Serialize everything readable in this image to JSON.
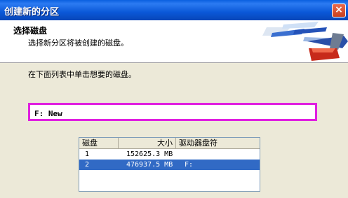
{
  "window": {
    "title": "创建新的分区",
    "close_glyph": "×"
  },
  "header": {
    "title": "选择磁盘",
    "subtitle": "选择新分区将被创建的磁盘。"
  },
  "instruction": "在下面列表中单击想要的磁盘。",
  "selected_field": {
    "value": "F:  New"
  },
  "disk_table": {
    "columns": [
      "磁盘",
      "大小",
      "驱动器盘符"
    ],
    "rows": [
      {
        "disk": "1",
        "size": "152625.3 MB",
        "letter": ""
      },
      {
        "disk": "2",
        "size": "476937.5 MB",
        "letter": "F:"
      }
    ],
    "selected_row": 2
  },
  "colors": {
    "title_bar": "#0A58D8",
    "highlight_border": "#E020E0",
    "selection": "#316AC5"
  }
}
